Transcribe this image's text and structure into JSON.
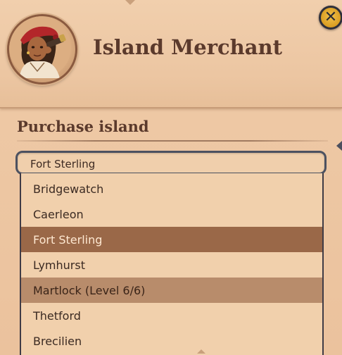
{
  "header": {
    "title": "Island Merchant",
    "avatar_icon": "merchant-portrait-icon",
    "close_icon": "close-x-icon",
    "close_glyph": "✕"
  },
  "section": {
    "title": "Purchase island"
  },
  "dropdown": {
    "selected_value": "Fort Sterling",
    "options": [
      {
        "label": "Bridgewatch",
        "state": "normal"
      },
      {
        "label": "Caerleon",
        "state": "normal"
      },
      {
        "label": "Fort Sterling",
        "state": "selected"
      },
      {
        "label": "Lymhurst",
        "state": "normal"
      },
      {
        "label": "Martlock (Level 6/6)",
        "state": "highlighted"
      },
      {
        "label": "Thetford",
        "state": "normal"
      },
      {
        "label": "Brecilien",
        "state": "normal"
      }
    ]
  },
  "colors": {
    "panel_bg": "#ecc7a4",
    "title_text": "#5b3a2c",
    "selected_row": "#9a6848",
    "highlighted_row": "#b88c6b",
    "close_button": "#d79a1f"
  }
}
